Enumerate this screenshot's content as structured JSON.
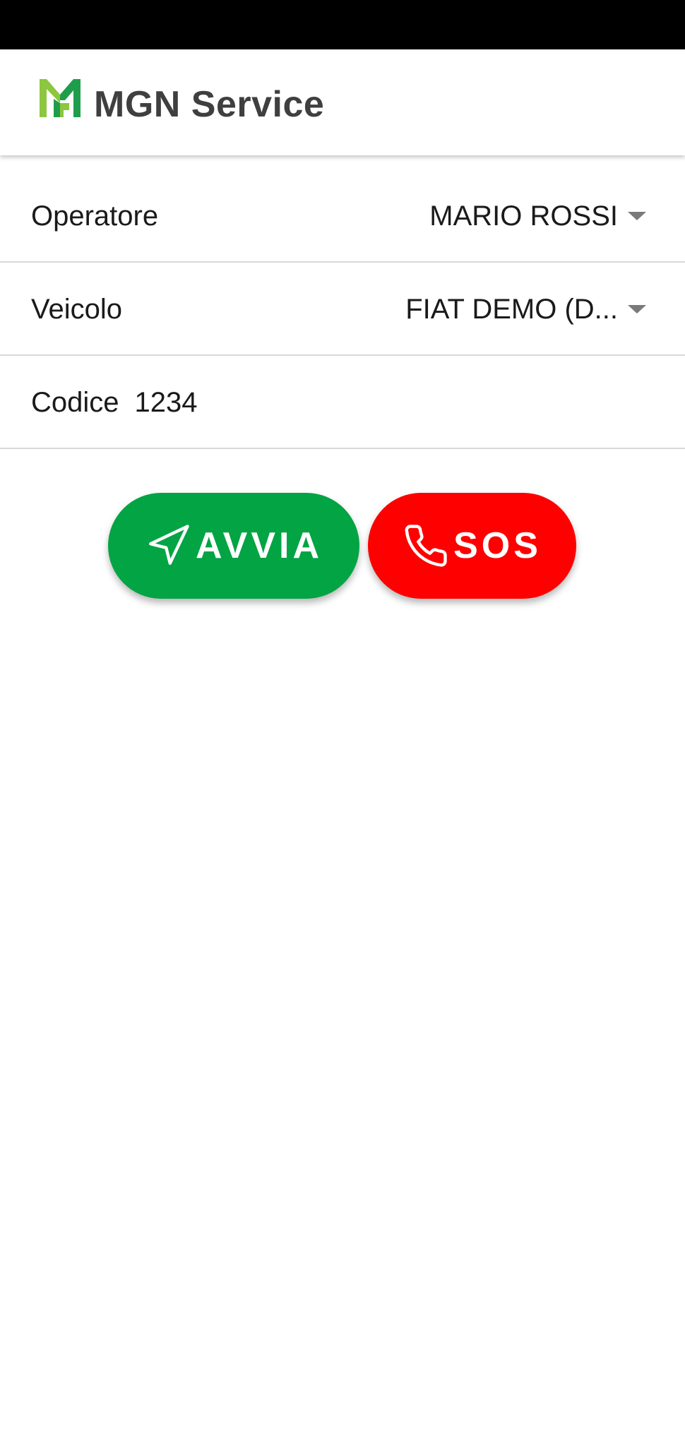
{
  "app": {
    "title": "MGN Service",
    "logo_icon": "mgn-logo",
    "colors": {
      "logo_light": "#8dc63f",
      "logo_dark": "#1e9e4a",
      "start": "#03a443",
      "sos": "#fe0000"
    }
  },
  "form": {
    "operatore": {
      "label": "Operatore",
      "value": "MARIO ROSSI",
      "icon": "dropdown-arrow-icon"
    },
    "veicolo": {
      "label": "Veicolo",
      "value": "FIAT DEMO (D...",
      "icon": "dropdown-arrow-icon"
    },
    "codice": {
      "label": "Codice",
      "value": "1234"
    }
  },
  "actions": {
    "avvia": {
      "label": "AVVIA",
      "icon": "navigation-arrow-icon"
    },
    "sos": {
      "label": "SOS",
      "icon": "phone-icon"
    }
  }
}
